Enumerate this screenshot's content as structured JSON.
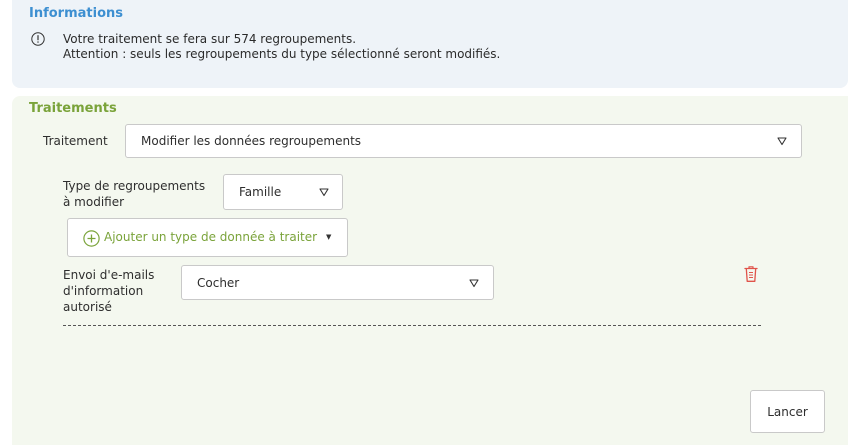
{
  "info": {
    "title": "Informations",
    "line1": "Votre traitement se fera sur 574 regroupements.",
    "line2": "Attention : seuls les regroupements du type sélectionné seront modifiés."
  },
  "treatments": {
    "title": "Traitements",
    "treatment_label": "Traitement",
    "treatment_value": "Modifier les données regroupements",
    "group_type_label_line1": "Type de regroupements",
    "group_type_label_line2": "à modifier",
    "group_type_value": "Famille",
    "add_button_label": "Ajouter un type de donnée à traiter",
    "email_label_line1": "Envoi d'e-mails",
    "email_label_line2": "d'information",
    "email_label_line3": "autorisé",
    "email_value": "Cocher",
    "launch_button_label": "Lancer"
  },
  "colors": {
    "info_title": "#3d8fd1",
    "treat_title": "#7aa33a",
    "delete_icon": "#e0534a"
  },
  "icons": {
    "info": "info-circle-icon",
    "add": "plus-circle-icon",
    "delete": "trash-icon",
    "dropdown": "chevron-down-icon"
  }
}
